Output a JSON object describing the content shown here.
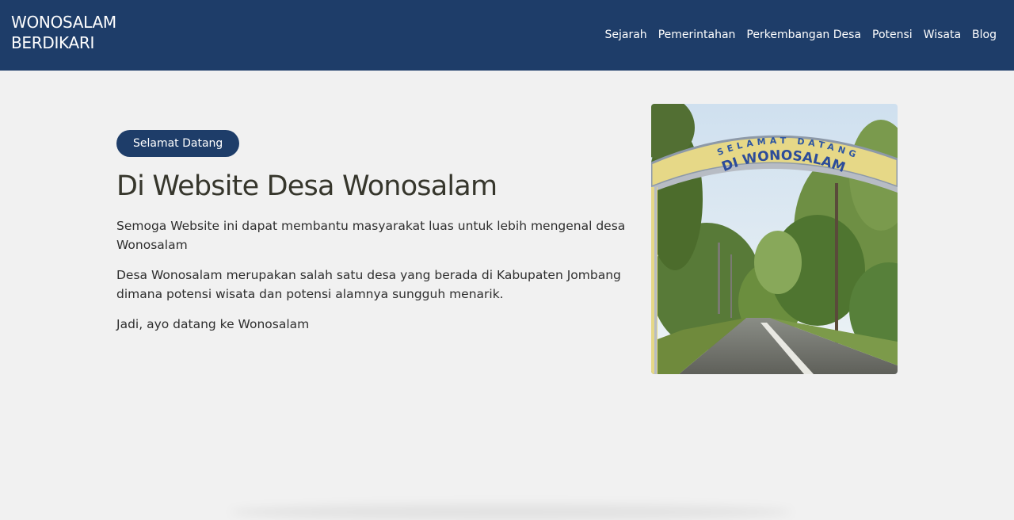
{
  "site": {
    "brand_line1": "WONOSALAM",
    "brand_line2": "BERDIKARI"
  },
  "nav": {
    "items": [
      {
        "label": "Sejarah"
      },
      {
        "label": "Pemerintahan"
      },
      {
        "label": "Perkembangan Desa"
      },
      {
        "label": "Potensi"
      },
      {
        "label": "Wisata"
      },
      {
        "label": "Blog"
      }
    ]
  },
  "hero": {
    "badge": "Selamat Datang",
    "title": "Di Website Desa Wonosalam",
    "paragraphs": [
      "Semoga Website ini dapat membantu masyarakat luas untuk lebih mengenal desa Wonosalam",
      "Desa Wonosalam merupakan salah satu desa yang berada di Kabupaten Jombang dimana potensi wisata dan potensi alamnya sungguh menarik.",
      "Jadi, ayo datang ke Wonosalam"
    ],
    "image": {
      "gate_line1": "SELAMAT DATANG",
      "gate_line2": "DI WONOSALAM"
    }
  },
  "colors": {
    "primary": "#1e3d69",
    "background": "#f1f1f1",
    "heading": "#36362c"
  }
}
